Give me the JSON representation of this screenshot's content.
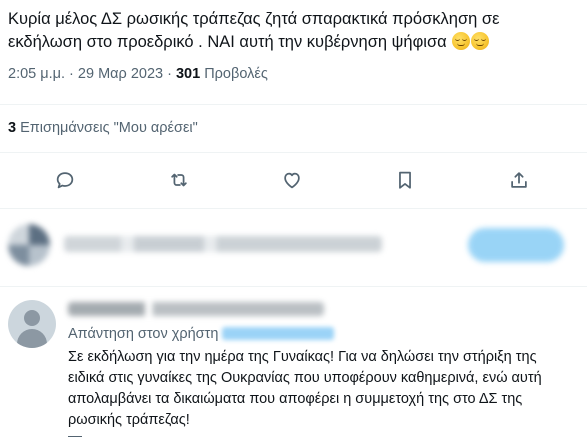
{
  "tweet": {
    "text": "Κυρία μέλος ΔΣ ρωσικής τράπεζας ζητά σπαρακτικά πρόσκληση σε εκδήλωση στο προεδρικό . ΝΑΙ αυτή την κυβέρνηση ψήφισα",
    "emojis": [
      "relieved-face-emoji",
      "relieved-face-emoji"
    ],
    "time": "2:05 μ.μ.",
    "separator": " · ",
    "date": "29 Μαρ 2023",
    "views_count": "301",
    "views_label": " Προβολές"
  },
  "engagement": {
    "likes_count": "3",
    "likes_label": " Επισημάνσεις \"Μου αρέσει\""
  },
  "actions": [
    {
      "name": "reply",
      "icon": "reply-bubble-icon"
    },
    {
      "name": "retweet",
      "icon": "retweet-arrows-icon"
    },
    {
      "name": "like",
      "icon": "heart-icon"
    },
    {
      "name": "bookmark",
      "icon": "bookmark-icon"
    },
    {
      "name": "share",
      "icon": "share-upload-icon"
    }
  ],
  "reply": {
    "replying_to_label": "Απάντηση στον χρήστη",
    "text": "Σε εκδήλωση για την ημέρα της Γυναίκας! Για να δηλώσει την στήριξη της ειδικά στις γυναίκες της Ουκρανίας που υποφέρουν καθημερινά, ενώ αυτή απολαμβάνει τα δικαιώματα που αποφέρει η συμμετοχή της στο ΔΣ της ρωσικής τράπεζας!"
  },
  "colors": {
    "text_primary": "#0f1419",
    "text_secondary": "#536471",
    "divider": "#eff3f4",
    "accent_blue": "#1d9bf0"
  }
}
